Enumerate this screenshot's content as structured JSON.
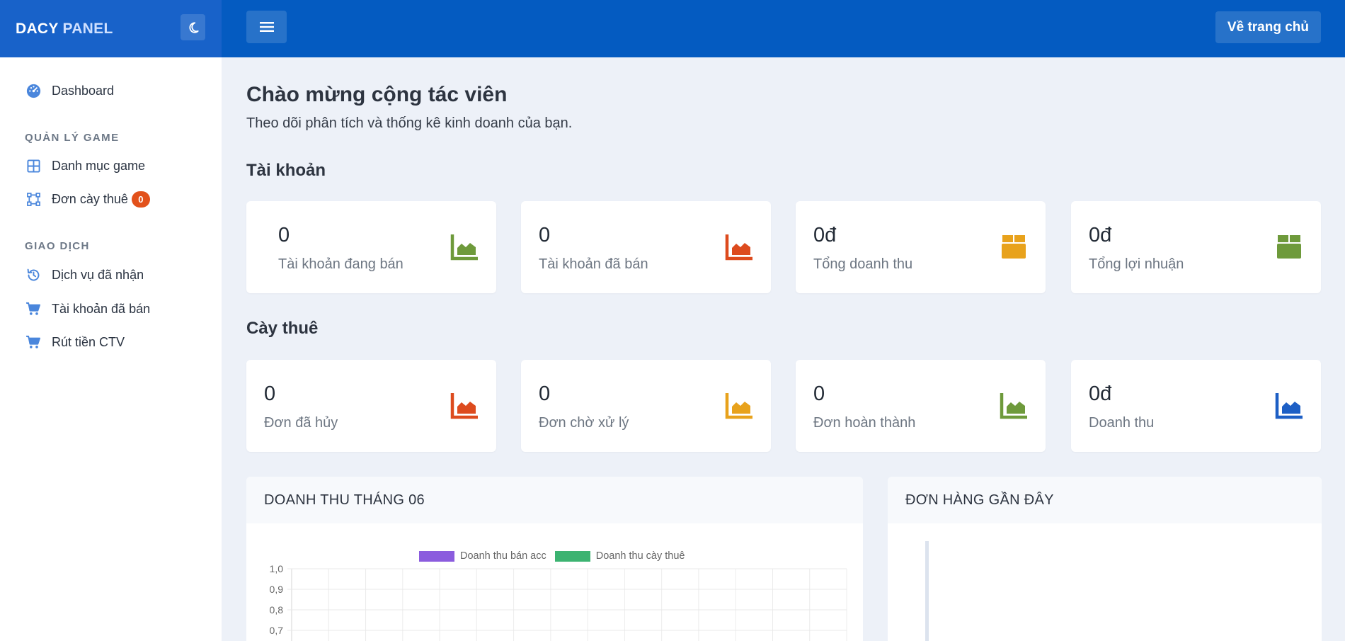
{
  "brand": {
    "part1": "DACY",
    "part2": " PANEL"
  },
  "header": {
    "home_label": "Về trang chủ"
  },
  "sidebar": {
    "dashboard": "Dashboard",
    "section_game": "QUẢN LÝ GAME",
    "game_category": "Danh mục game",
    "boost_orders": "Đơn cày thuê",
    "boost_orders_badge": "0",
    "section_transactions": "GIAO DỊCH",
    "services_received": "Dịch vụ đã nhận",
    "accounts_sold": "Tài khoản đã bán",
    "withdraw": "Rút tiền CTV"
  },
  "main": {
    "title": "Chào mừng cộng tác viên",
    "subtitle": "Theo dõi phân tích và thống kê kinh doanh của bạn.",
    "accounts_section": "Tài khoản",
    "boost_section": "Cày thuê"
  },
  "account_cards": [
    {
      "value": "0",
      "label": "Tài khoản đang bán",
      "icon": "area-chart-icon",
      "color": "#6e9a3b"
    },
    {
      "value": "0",
      "label": "Tài khoản đã bán",
      "icon": "area-chart-icon",
      "color": "#dd4b1e"
    },
    {
      "value": "0đ",
      "label": "Tổng doanh thu",
      "icon": "box-icon",
      "color": "#e8a21c"
    },
    {
      "value": "0đ",
      "label": "Tổng lợi nhuận",
      "icon": "box-icon",
      "color": "#6e9a3b"
    }
  ],
  "boost_cards": [
    {
      "value": "0",
      "label": "Đơn đã hủy",
      "icon": "area-chart-icon",
      "color": "#dd4b1e"
    },
    {
      "value": "0",
      "label": "Đơn chờ xử lý",
      "icon": "area-chart-icon",
      "color": "#e8a21c"
    },
    {
      "value": "0",
      "label": "Đơn hoàn thành",
      "icon": "area-chart-icon",
      "color": "#6e9a3b"
    },
    {
      "value": "0đ",
      "label": "Doanh thu",
      "icon": "area-chart-icon",
      "color": "#1d5fc5"
    }
  ],
  "revenue_panel": {
    "title": "DOANH THU THÁNG 06"
  },
  "recent_orders_panel": {
    "title": "ĐƠN HÀNG GẦN ĐÂY"
  },
  "chart_data": {
    "type": "line",
    "title": "",
    "series": [
      {
        "name": "Doanh thu bán acc",
        "color": "#8b5cde",
        "values": []
      },
      {
        "name": "Doanh thu cày thuê",
        "color": "#3cb371",
        "values": []
      }
    ],
    "y_ticks": [
      "1,0",
      "0,9",
      "0,8",
      "0,7"
    ],
    "ylim": [
      0,
      1.0
    ],
    "grid": true,
    "legend_position": "top"
  }
}
